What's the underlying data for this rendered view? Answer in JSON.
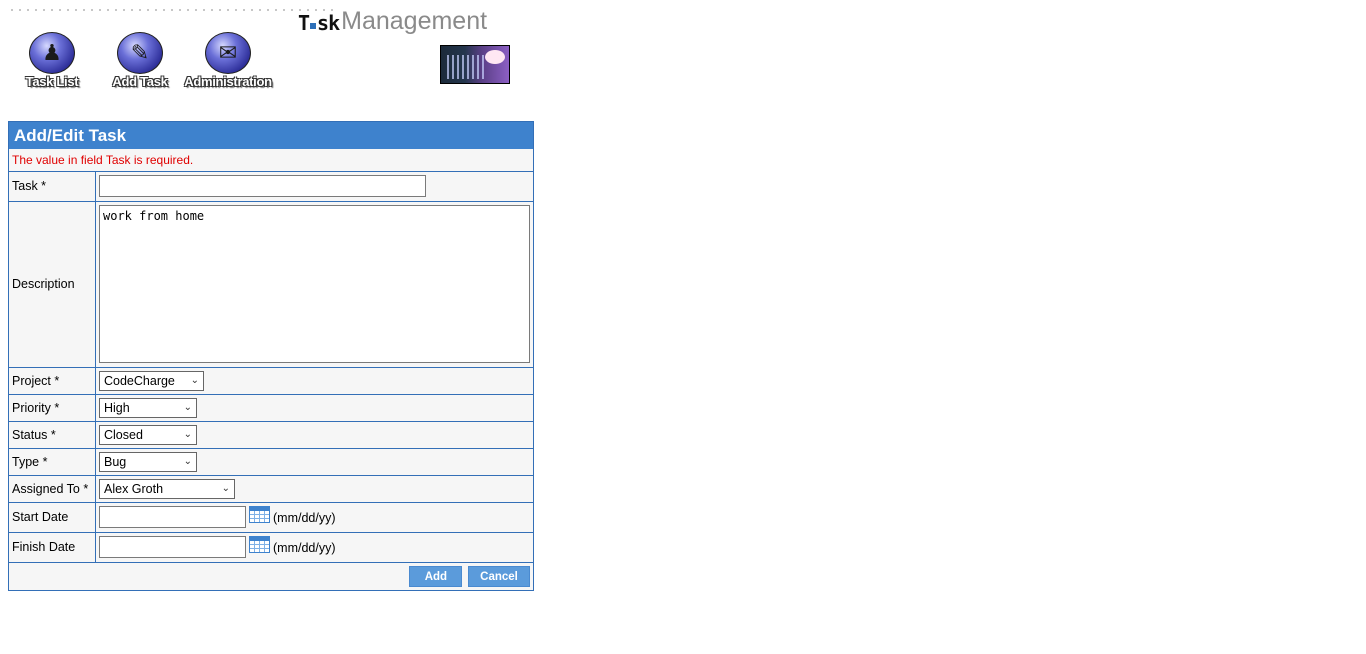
{
  "logo": {
    "part1_a": "T",
    "part1_b": "sk",
    "part2": "Management"
  },
  "nav": [
    {
      "label": "Task List",
      "icon": "person-with-list-icon"
    },
    {
      "label": "Add Task",
      "icon": "person-at-desk-icon"
    },
    {
      "label": "Administration",
      "icon": "document-with-pen-icon"
    }
  ],
  "form": {
    "title": "Add/Edit Task",
    "error": "The value in field Task is required.",
    "fields": {
      "task": {
        "label": "Task *",
        "value": ""
      },
      "description": {
        "label": "Description",
        "value": "work from home"
      },
      "project": {
        "label": "Project *",
        "value": "CodeCharge"
      },
      "priority": {
        "label": "Priority *",
        "value": "High"
      },
      "status": {
        "label": "Status *",
        "value": "Closed"
      },
      "type": {
        "label": "Type *",
        "value": "Bug"
      },
      "assigned_to": {
        "label": "Assigned To *",
        "value": "Alex Groth"
      },
      "start_date": {
        "label": "Start Date",
        "value": "",
        "format": "(mm/dd/yy)"
      },
      "finish_date": {
        "label": "Finish Date",
        "value": "",
        "format": "(mm/dd/yy)"
      }
    },
    "buttons": {
      "add": "Add",
      "cancel": "Cancel"
    }
  },
  "colors": {
    "header_blue": "#3e82cd",
    "border_blue": "#336fb7",
    "error_red": "#e00000",
    "button_blue": "#5b9bdb"
  }
}
